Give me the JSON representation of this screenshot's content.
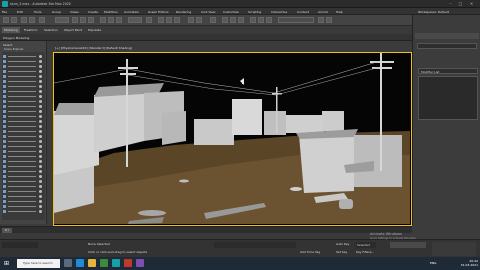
{
  "window": {
    "title": "slum_3.max - Autodesk 3ds Max 2020"
  },
  "menu": [
    "File",
    "Edit",
    "Tools",
    "Group",
    "Views",
    "Create",
    "Modifiers",
    "Animation",
    "Graph Editors",
    "Rendering",
    "Civil View",
    "Customize",
    "Scripting",
    "Interactive",
    "Content",
    "Arnold",
    "Help"
  ],
  "ribbon_tabs": [
    "Modeling",
    "Freeform",
    "Selection",
    "Object Paint",
    "Populate"
  ],
  "ribbon_sub": "Polygon Modeling",
  "left_panel": {
    "header": "Select",
    "root_label": "Scene Explorer"
  },
  "viewport": {
    "label": "[+] [PhysCamera001] [Standard] [Default Shading]"
  },
  "right_panel": {
    "modifier_list": "Modifier List",
    "workspace": "Workspaces: Default"
  },
  "timeline": {
    "slider": "0 / 100"
  },
  "status": {
    "selection": "None Selected",
    "prompt": "Click or click-and-drag to select objects",
    "add_time_tag": "Add Time Tag",
    "autokey": "Auto Key",
    "setkey": "Set Key",
    "selected": "Selected",
    "key_filters": "Key Filters..."
  },
  "watermark": {
    "title": "Activate Windows",
    "subtitle": "Go to Settings to activate Windows."
  },
  "taskbar": {
    "search_placeholder": "Type here to search",
    "time": "20:42",
    "date": "31-03-2021",
    "lang": "ENG"
  }
}
